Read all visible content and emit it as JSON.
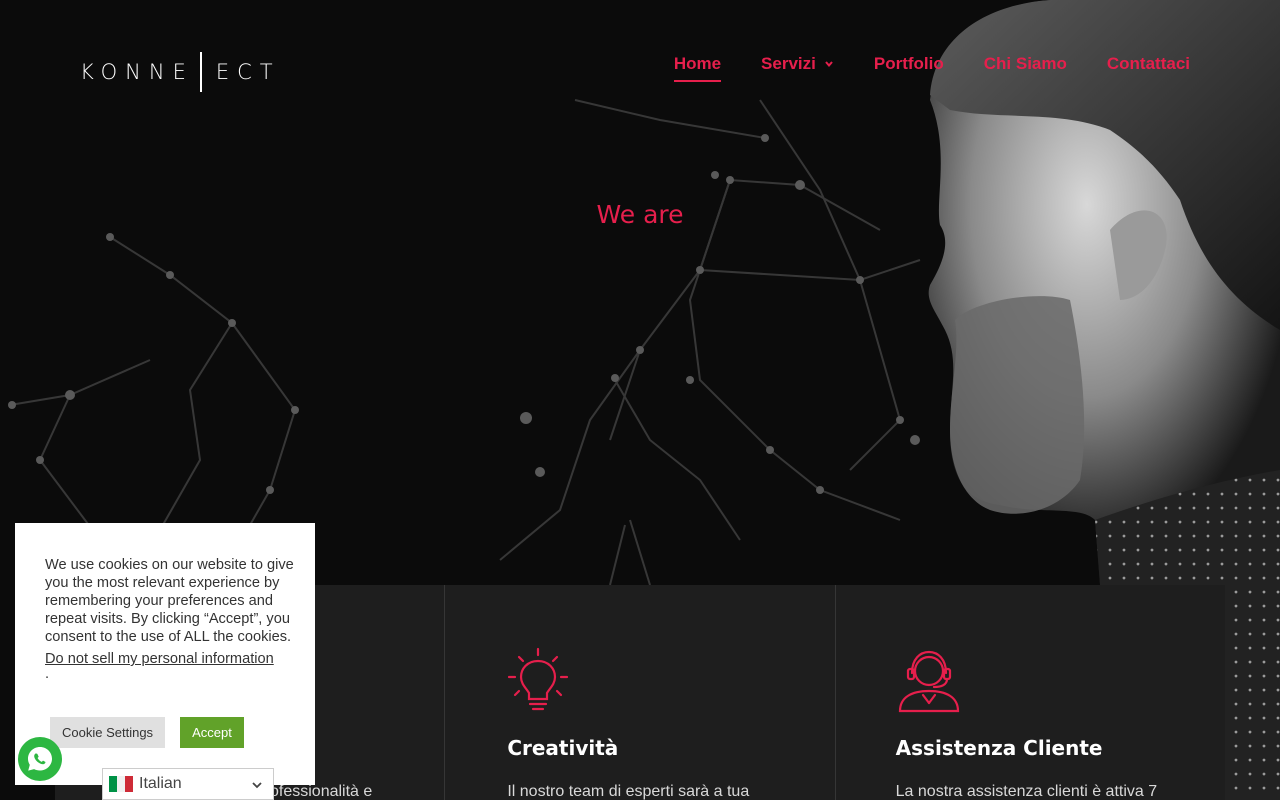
{
  "logo": {
    "part1": "KONNE",
    "part2": "ECT"
  },
  "nav": {
    "items": [
      {
        "label": "Home",
        "active": true
      },
      {
        "label": "Servizi",
        "has_dropdown": true
      },
      {
        "label": "Portfolio"
      },
      {
        "label": "Chi Siamo"
      },
      {
        "label": "Contattaci"
      }
    ]
  },
  "hero": {
    "title": "We are"
  },
  "services": [
    {
      "title": "",
      "text": "ofessionalità e",
      "icon": ""
    },
    {
      "title": "Creatività",
      "text": "Il nostro team di esperti sarà a tua",
      "icon": "lightbulb-icon"
    },
    {
      "title": "Assistenza Cliente",
      "text": "La nostra assistenza clienti è attiva 7",
      "icon": "headset-icon"
    }
  ],
  "cookie": {
    "text": "We use cookies on our website to give you the most relevant experience by remembering your preferences and repeat visits. By clicking “Accept”, you consent to the use of ALL the cookies.",
    "link": "Do not sell my personal information",
    "trailing": ".",
    "settings_label": "Cookie Settings",
    "accept_label": "Accept"
  },
  "language": {
    "selected": "Italian"
  },
  "colors": {
    "accent": "#e61f4c",
    "accept": "#61a229",
    "whatsapp": "#2db742"
  }
}
